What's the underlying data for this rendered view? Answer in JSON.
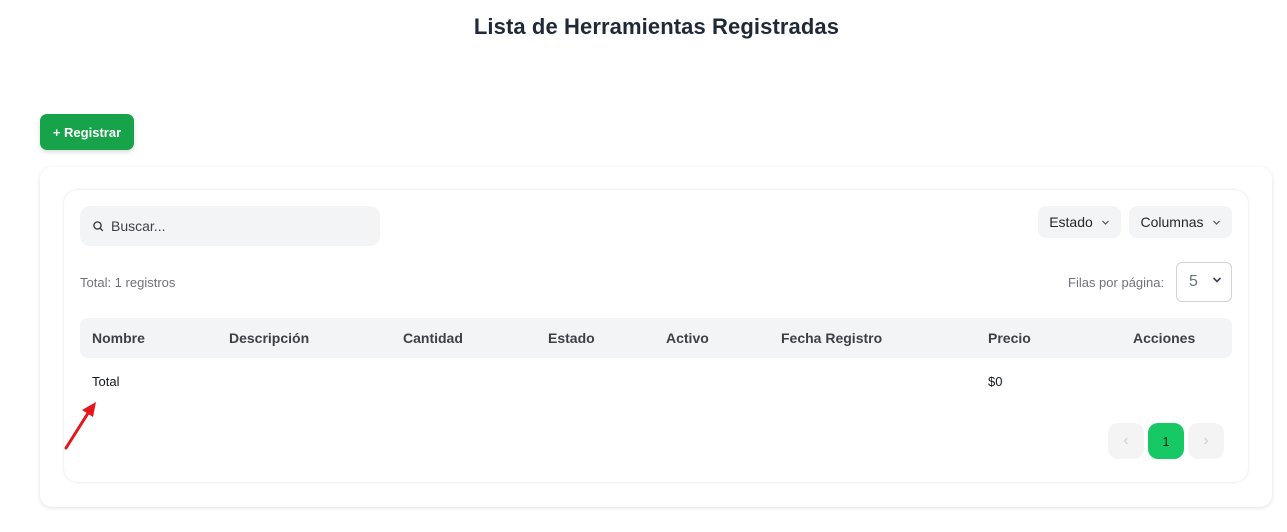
{
  "header": {
    "title": "Lista de Herramientas Registradas"
  },
  "toolbar": {
    "register_label": "+ Registrar"
  },
  "search": {
    "placeholder": "Buscar..."
  },
  "filters": {
    "estado_label": "Estado",
    "columnas_label": "Columnas"
  },
  "summary": {
    "total_text": "Total: 1 registros",
    "rows_per_page_label": "Filas por página:",
    "rows_per_page_value": "5"
  },
  "table": {
    "columns": [
      "Nombre",
      "Descripción",
      "Cantidad",
      "Estado",
      "Activo",
      "Fecha Registro",
      "Precio",
      "Acciones"
    ],
    "rows": [
      {
        "nombre": "Total",
        "precio": "$0"
      }
    ]
  },
  "pagination": {
    "current_page": "1",
    "prev_icon": "chevron-left-icon",
    "next_icon": "chevron-right-icon"
  },
  "colors": {
    "primary_green": "#16a34a",
    "page_active": "#17c964",
    "annotation_arrow": "#e5161b"
  }
}
